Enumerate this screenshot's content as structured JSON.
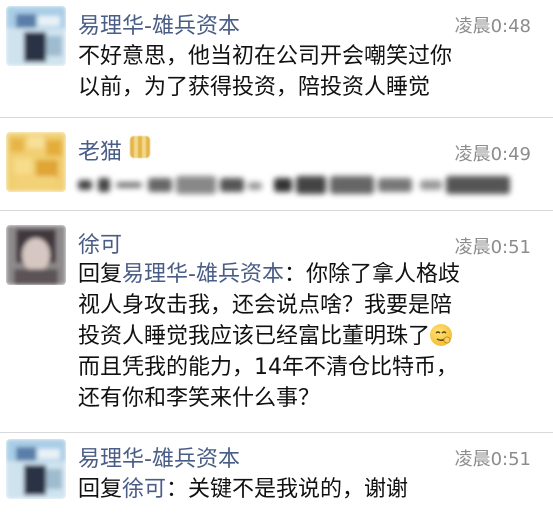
{
  "messages": [
    {
      "sender": "易理华-雄兵资本",
      "time": "凌晨0:48",
      "avatar_icon": "blurred-avatar",
      "lines": [
        "不好意思，他当初在公司开会嘲笑过你",
        "以前，为了获得投资，陪投资人睡觉"
      ]
    },
    {
      "sender": "老猫",
      "time": "凌晨0:49",
      "avatar_icon": "blurred-avatar",
      "badge_icon": "blurred-badge",
      "obscured_text": true
    },
    {
      "sender": "徐可",
      "time": "凌晨0:51",
      "avatar_icon": "blurred-avatar",
      "reply_prefix": "回复",
      "reply_to": "易理华-雄兵资本",
      "reply_sep": "：",
      "lines": [
        "你除了拿人格歧",
        "视人身攻击我，还会说点啥？我要是陪",
        "投资人睡觉我应该已经富比董明珠了",
        "而且凭我的能力，14年不清仓比特币，",
        "还有你和李笑来什么事？"
      ],
      "emoji_icon": "smirk-emoji-icon"
    },
    {
      "sender": "易理华-雄兵资本",
      "time": "凌晨0:51",
      "avatar_icon": "blurred-avatar",
      "reply_prefix": "回复",
      "reply_to": "徐可",
      "reply_sep": "：",
      "lines": [
        "关键不是我说的，谢谢"
      ]
    }
  ],
  "colors": {
    "name": "#4a5d86",
    "time": "#8c8c8c",
    "divider": "#d9d9d9"
  }
}
